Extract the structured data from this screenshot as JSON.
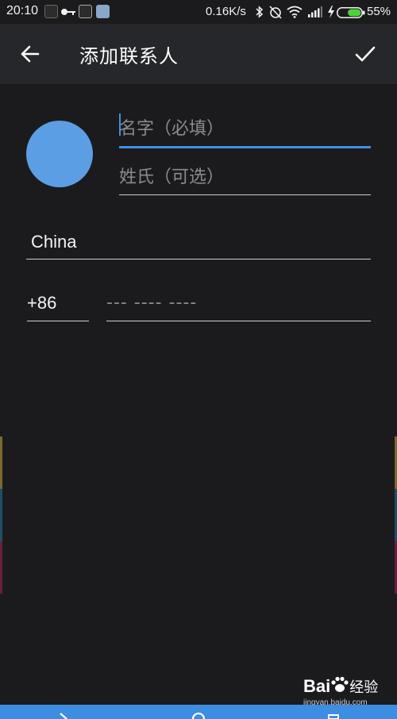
{
  "status_bar": {
    "time": "20:10",
    "network_speed": "0.16K/s",
    "battery_percent": "55%",
    "icons": [
      "notification-app-icon",
      "key-icon",
      "notification-app-icon-2",
      "notification-app-icon-3",
      "bluetooth-icon",
      "alarm-off-icon",
      "wifi-icon",
      "signal-icon",
      "charging-icon",
      "battery-icon"
    ]
  },
  "toolbar": {
    "title": "添加联系人",
    "back_icon": "arrow-left-icon",
    "done_icon": "checkmark-icon"
  },
  "form": {
    "first_name": {
      "placeholder": "名字（必填）",
      "value": "",
      "accent": "#3f8ee6"
    },
    "last_name": {
      "placeholder": "姓氏（可选）",
      "value": ""
    },
    "country": {
      "value": "China"
    },
    "country_code": {
      "value": "+86"
    },
    "phone": {
      "placeholder": "--- ---- ----",
      "value": ""
    }
  },
  "watermark": {
    "brand": "Bai",
    "brand_suffix": "经验",
    "url": "jingyan.baidu.com"
  },
  "colors": {
    "background": "#1b1b1d",
    "toolbar": "#26272a",
    "avatar": "#5c9ee3",
    "accent": "#3f8ee6",
    "nav_bar": "#3d8de2"
  }
}
